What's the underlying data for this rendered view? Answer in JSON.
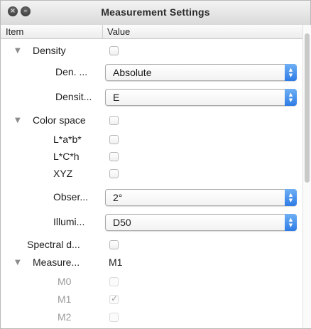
{
  "window": {
    "title": "Measurement Settings"
  },
  "header": {
    "item": "Item",
    "value": "Value"
  },
  "rows": [
    {
      "label": "Density",
      "type": "group",
      "checked": false
    },
    {
      "label": "Den. ...",
      "type": "popup",
      "value": "Absolute"
    },
    {
      "label": "Densit...",
      "type": "popup",
      "value": "E"
    },
    {
      "label": "Color space",
      "type": "group",
      "checked": false
    },
    {
      "label": "L*a*b*",
      "type": "checkbox",
      "checked": false
    },
    {
      "label": "L*C*h",
      "type": "checkbox",
      "checked": false
    },
    {
      "label": "XYZ",
      "type": "checkbox",
      "checked": false
    },
    {
      "label": "Obser...",
      "type": "popup",
      "value": "2°"
    },
    {
      "label": "Illumi...",
      "type": "popup",
      "value": "D50"
    },
    {
      "label": "Spectral d...",
      "type": "checkbox",
      "checked": false
    },
    {
      "label": "Measure...",
      "type": "group-text",
      "value": "M1"
    },
    {
      "label": "M0",
      "type": "checkbox",
      "checked": false,
      "disabled": true
    },
    {
      "label": "M1",
      "type": "checkbox",
      "checked": true,
      "disabled": true
    },
    {
      "label": "M2",
      "type": "checkbox",
      "checked": false,
      "disabled": true
    }
  ],
  "icons": {
    "close": "close-icon",
    "minimize": "minimize-icon",
    "disclosure": "disclosure-triangle-icon",
    "popup": "updown-arrows-icon"
  },
  "colors": {
    "accent": "#2d7be5",
    "disabled_text": "#9b9b9b"
  }
}
